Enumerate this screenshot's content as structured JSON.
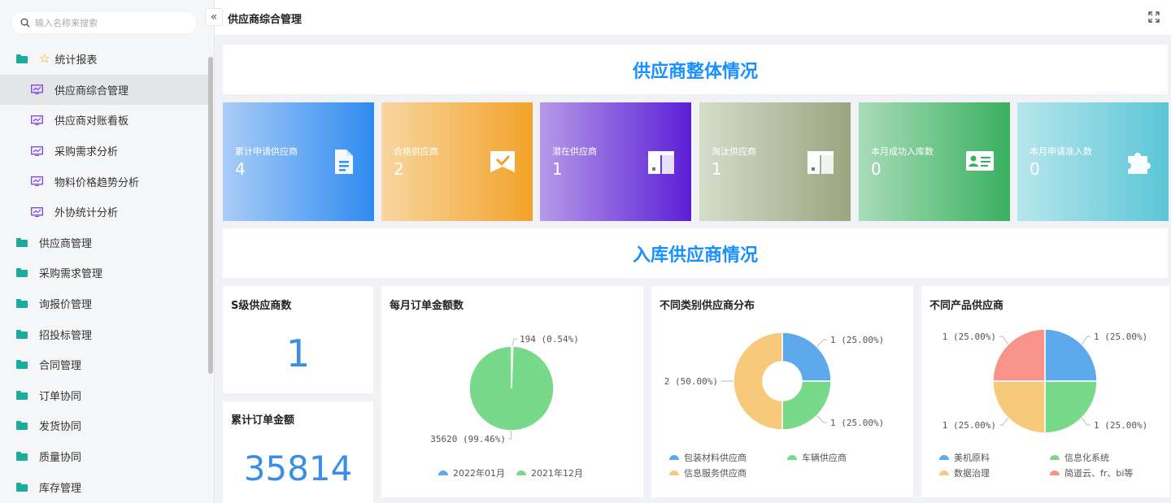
{
  "search": {
    "placeholder": "输入名称来搜索"
  },
  "sidebar": {
    "items": [
      {
        "label": "统计报表",
        "level": "top",
        "icon": "star-icon"
      },
      {
        "label": "供应商综合管理",
        "level": "sub",
        "active": true
      },
      {
        "label": "供应商对账看板",
        "level": "sub"
      },
      {
        "label": "采购需求分析",
        "level": "sub"
      },
      {
        "label": "物料价格趋势分析",
        "level": "sub"
      },
      {
        "label": "外协统计分析",
        "level": "sub"
      },
      {
        "label": "供应商管理",
        "level": "top"
      },
      {
        "label": "采购需求管理",
        "level": "top"
      },
      {
        "label": "询报价管理",
        "level": "top"
      },
      {
        "label": "招投标管理",
        "level": "top"
      },
      {
        "label": "合同管理",
        "level": "top"
      },
      {
        "label": "订单协同",
        "level": "top"
      },
      {
        "label": "发货协同",
        "level": "top"
      },
      {
        "label": "质量协同",
        "level": "top"
      },
      {
        "label": "库存管理",
        "level": "top"
      }
    ]
  },
  "header": {
    "collapse_glyph": "«",
    "title": "供应商综合管理"
  },
  "sections": {
    "overall": "供应商整体情况",
    "inbound": "入库供应商情况"
  },
  "cards": [
    {
      "label": "累计申请供应商",
      "value": "4",
      "icon": "document-icon",
      "from": "#a9cdf8",
      "to": "#2f8bf0"
    },
    {
      "label": "合格供应商",
      "value": "2",
      "icon": "badge-check-icon",
      "from": "#f8d6a0",
      "to": "#f2a32a"
    },
    {
      "label": "潜在供应商",
      "value": "1",
      "icon": "box-icon",
      "from": "#b59ae8",
      "to": "#5b1fd6"
    },
    {
      "label": "淘汰供应商",
      "value": "1",
      "icon": "box-icon",
      "from": "#d6dccb",
      "to": "#9aa580"
    },
    {
      "label": "本月成功入库数",
      "value": "0",
      "icon": "id-card-icon",
      "from": "#a8dcb8",
      "to": "#3ab060"
    },
    {
      "label": "本月申请准入数",
      "value": "0",
      "icon": "puzzle-icon",
      "from": "#b8e6ec",
      "to": "#5ac6d6"
    }
  ],
  "stats": {
    "s_level": {
      "title": "S级供应商数",
      "value": "1"
    },
    "total_order": {
      "title": "累计订单金额",
      "value": "35814"
    }
  },
  "colors": {
    "blue": "#5ea9ec",
    "green": "#78d98a",
    "yellow": "#f7c97a",
    "red": "#f7938a",
    "accent": "#1890ff"
  },
  "chart_data": [
    {
      "type": "pie",
      "title": "每月订单金额数",
      "labels": [
        "2022年01月",
        "2021年12月"
      ],
      "values": [
        194,
        35620
      ],
      "data_labels": [
        "194 (0.54%)",
        "35620 (99.46%)"
      ]
    },
    {
      "type": "pie",
      "variant": "donut",
      "title": "不同类别供应商分布",
      "labels": [
        "包装材料供应商",
        "车辆供应商",
        "信息服务供应商"
      ],
      "values": [
        1,
        1,
        2
      ],
      "data_labels": [
        "1 (25.00%)",
        "1 (25.00%)",
        "2 (50.00%)"
      ]
    },
    {
      "type": "pie",
      "title": "不同产品供应商",
      "labels": [
        "美机原料",
        "信息化系统",
        "数据治理",
        "简道云、fr、bi等"
      ],
      "values": [
        1,
        1,
        1,
        1
      ],
      "data_labels": [
        "1 (25.00%)",
        "1 (25.00%)",
        "1 (25.00%)",
        "1 (25.00%)"
      ]
    }
  ]
}
